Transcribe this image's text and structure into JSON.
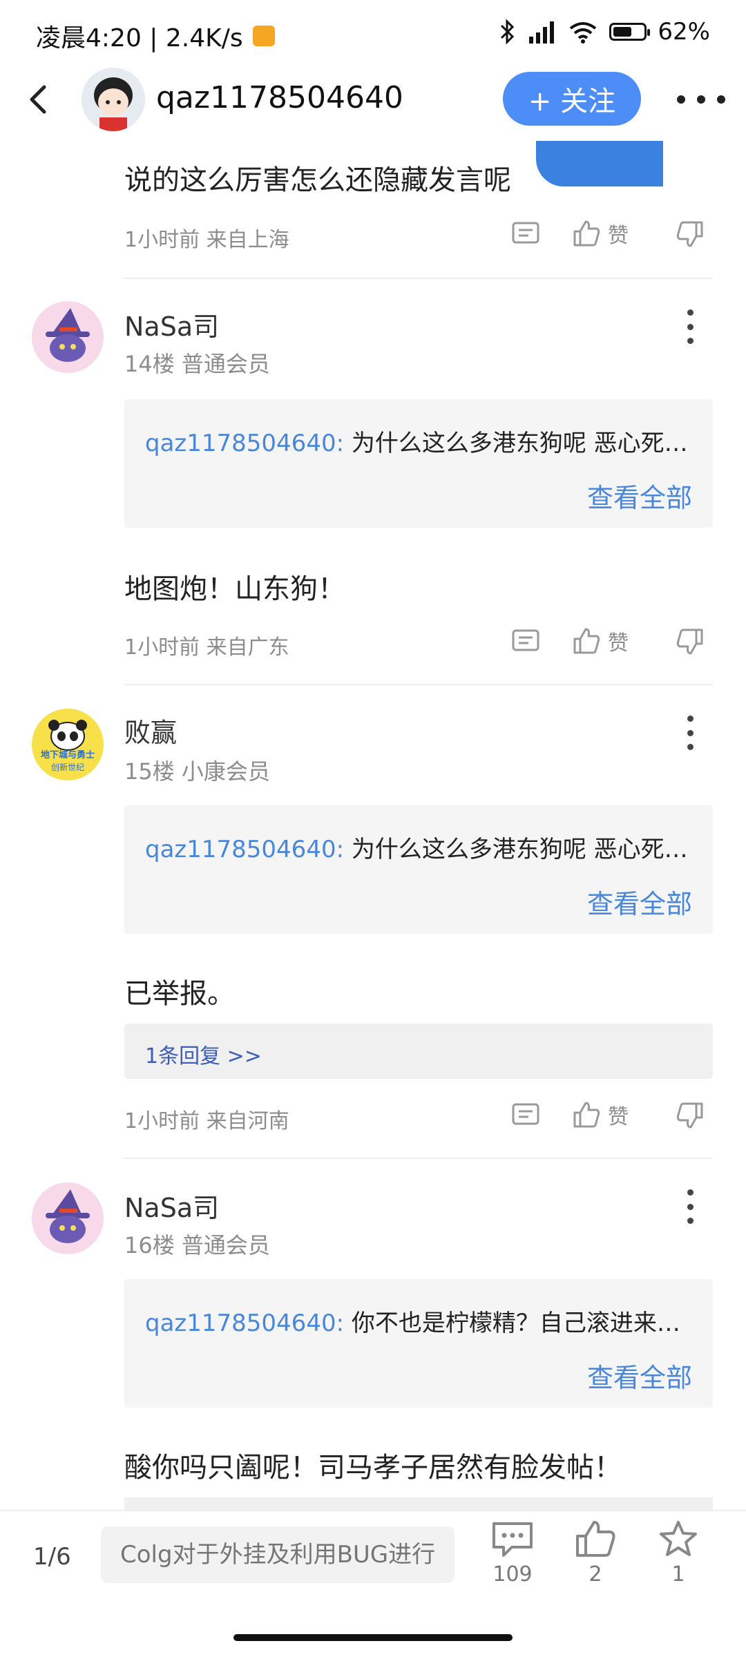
{
  "status_bar": {
    "time_speed": "凌晨4:20 | 2.4K/s",
    "battery": "62%",
    "battery_level": 0.62
  },
  "header": {
    "username": "qaz1178504640",
    "follow_label": "+ 关注"
  },
  "comments": [
    {
      "text": "说的这么厉害怎么还隐藏发言呢",
      "meta": "1小时前 来自上海",
      "like_label": "赞"
    },
    {
      "username": "NaSa司",
      "floor": "14楼 普通会员",
      "quote_user": "qaz1178504640:",
      "quote_text": " 为什么这么多港东狗呢 恶心死我了",
      "quote_more": "查看全部",
      "text": "地图炮！山东狗！",
      "meta": "1小时前 来自广东",
      "like_label": "赞"
    },
    {
      "username": "败赢",
      "floor": "15楼 小康会员",
      "avatar_text": [
        "地下城与勇士",
        "创新世纪"
      ],
      "quote_user": "qaz1178504640:",
      "quote_text": " 为什么这么多港东狗呢 恶心死我了",
      "quote_more": "查看全部",
      "text": "已举报。",
      "reply_link": "1条回复 >>",
      "meta": "1小时前 来自河南",
      "like_label": "赞"
    },
    {
      "username": "NaSa司",
      "floor": "16楼 普通会员",
      "quote_user": "qaz1178504640:",
      "quote_text": " 你不也是柠檬精？自己滚进来挨骂了",
      "quote_more": "查看全部",
      "text": "酸你吗只阖呢！司马孝子居然有脸发帖！"
    }
  ],
  "bottom_bar": {
    "page": "1/6",
    "input_placeholder": "Colg对于外挂及利用BUG进行处罚",
    "comment_count": "109",
    "like_count": "2",
    "fav_count": "1"
  },
  "colors": {
    "accent": "#4d8df7",
    "link": "#4a86d9",
    "reply_link": "#3c5db8",
    "meta": "#8c8c8c"
  },
  "icons": [
    "back-icon",
    "bluetooth-icon",
    "signal-icon",
    "wifi-icon",
    "battery-icon",
    "more-icon",
    "comment-icon",
    "thumb-up-icon",
    "thumb-down-icon",
    "star-icon",
    "kebab-icon"
  ]
}
